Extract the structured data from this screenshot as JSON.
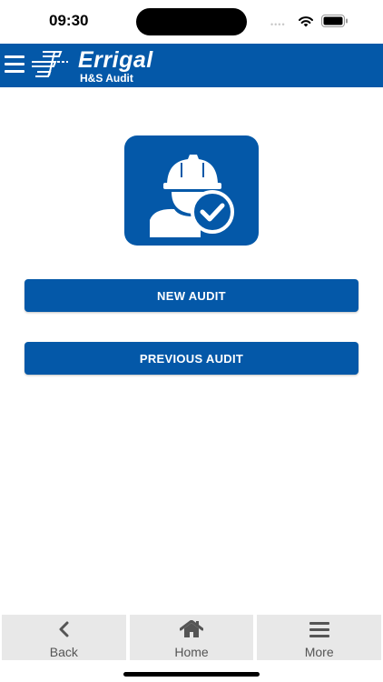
{
  "status_bar": {
    "time": "09:30",
    "signal": "••••"
  },
  "header": {
    "brand": "Errigal",
    "subtitle": "H&S Audit",
    "menu_icon": "menu-icon",
    "logo": "errigal-logo"
  },
  "hero": {
    "icon": "worker-check-icon"
  },
  "actions": {
    "new_audit": "NEW AUDIT",
    "previous_audit": "PREVIOUS AUDIT"
  },
  "bottom_nav": [
    {
      "label": "Back",
      "icon": "chevron-left-icon"
    },
    {
      "label": "Home",
      "icon": "home-icon"
    },
    {
      "label": "More",
      "icon": "menu-icon"
    }
  ],
  "colors": {
    "primary": "#0458a8",
    "nav_bg": "#e8e8e8",
    "nav_text": "#555555"
  }
}
